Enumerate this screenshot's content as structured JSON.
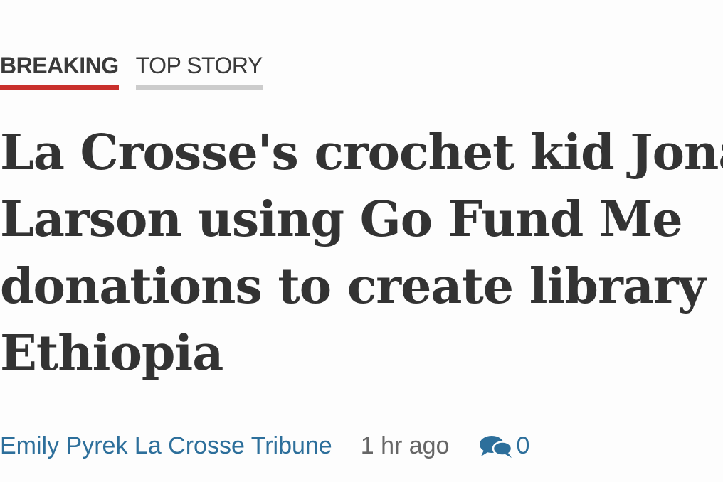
{
  "tags": {
    "breaking": "BREAKING",
    "top_story": "TOP STORY"
  },
  "headline": {
    "lines": [
      "La Crosse's crochet kid Jonah",
      "Larson using Go Fund Me",
      "donations to create library in",
      "Ethiopia"
    ]
  },
  "byline": {
    "author": "Emily Pyrek La Crosse Tribune",
    "time": "1 hr ago",
    "comment_count": "0",
    "comment_icon": "comment-bubbles-icon"
  },
  "colors": {
    "breaking_accent": "#c9302c",
    "top_story_accent": "#cccccc",
    "link": "#2d6f9b",
    "headline_text": "#333333"
  }
}
